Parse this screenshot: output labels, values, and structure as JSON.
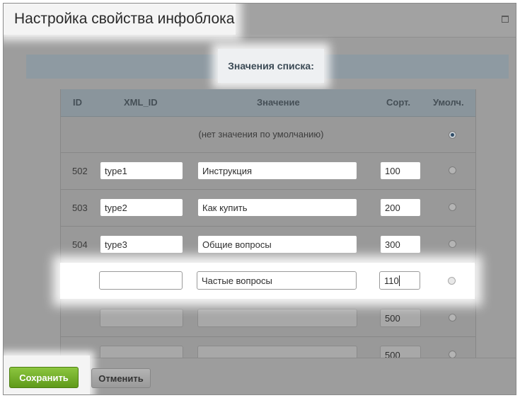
{
  "dialog": {
    "title": "Настройка свойства инфоблока",
    "section_title": "Значения списка:"
  },
  "table": {
    "headers": {
      "id": "ID",
      "xml_id": "XML_ID",
      "value": "Значение",
      "sort": "Сорт.",
      "default": "Умолч."
    },
    "no_default_label": "(нет значения по умолчанию)",
    "rows": [
      {
        "id": "502",
        "xml_id": "type1",
        "value": "Инструкция",
        "sort": "100"
      },
      {
        "id": "503",
        "xml_id": "type2",
        "value": "Как купить",
        "sort": "200"
      },
      {
        "id": "504",
        "xml_id": "type3",
        "value": "Общие вопросы",
        "sort": "300"
      },
      {
        "id": "",
        "xml_id": "",
        "value": "Частые вопросы",
        "sort": "110"
      },
      {
        "id": "",
        "xml_id": "",
        "value": "",
        "sort": "500"
      },
      {
        "id": "",
        "xml_id": "",
        "value": "",
        "sort": "500"
      }
    ]
  },
  "footer": {
    "save_label": "Сохранить",
    "cancel_label": "Отменить"
  }
}
